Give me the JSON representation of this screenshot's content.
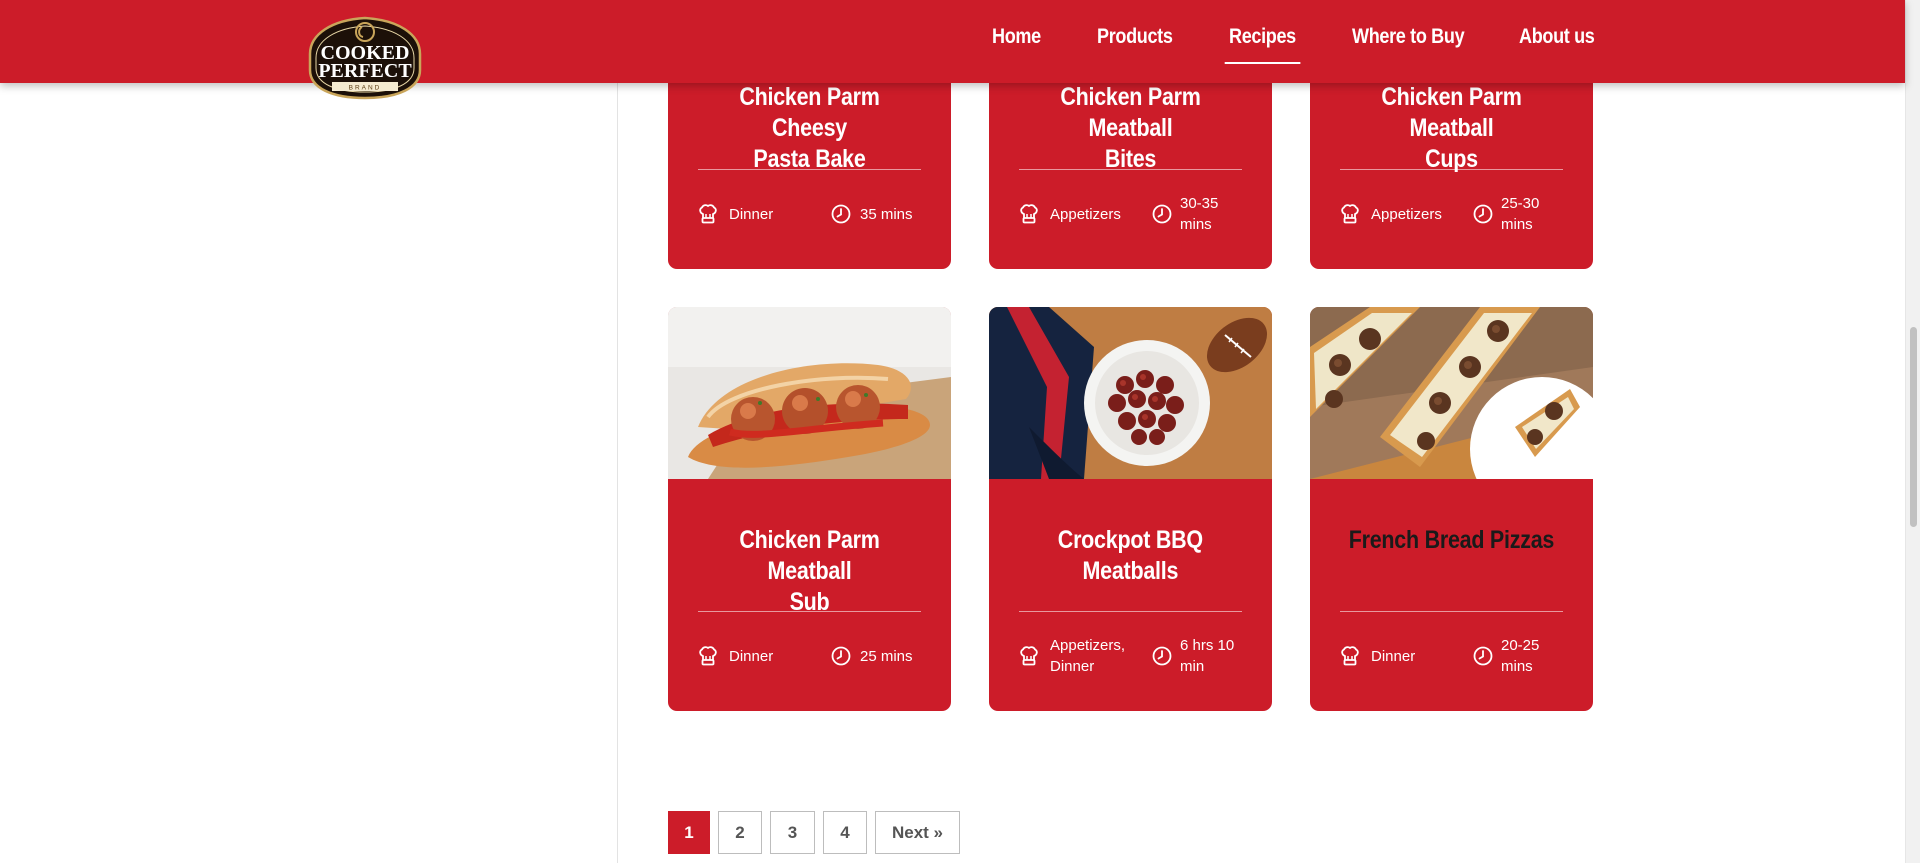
{
  "brand": {
    "logo_line1": "COOKED",
    "logo_line2": "PERFECT",
    "logo_line3": "BRAND",
    "accent": "#cc1c29"
  },
  "nav": {
    "items": [
      {
        "label": "Home"
      },
      {
        "label": "Products"
      },
      {
        "label": "Recipes",
        "active": true
      },
      {
        "label": "Where to Buy"
      },
      {
        "label": "About us"
      }
    ]
  },
  "recipes": [
    {
      "title_line1": "Chicken Parm Cheesy",
      "title_line2": "Pasta Bake",
      "category": "Dinner",
      "time": "35 mins",
      "category_icon": "chef-hat-icon",
      "time_icon": "clock-icon"
    },
    {
      "title_line1": "Chicken Parm Meatball",
      "title_line2": "Bites",
      "category": "Appetizers",
      "time_line1": "30-35",
      "time_line2": "mins",
      "category_icon": "chef-hat-icon",
      "time_icon": "clock-icon"
    },
    {
      "title_line1": "Chicken Parm Meatball",
      "title_line2": "Cups",
      "category": "Appetizers",
      "time_line1": "25-30",
      "time_line2": "mins",
      "category_icon": "chef-hat-icon",
      "time_icon": "clock-icon"
    },
    {
      "title_line1": "Chicken Parm Meatball",
      "title_line2": "Sub",
      "category": "Dinner",
      "time": "25 mins",
      "image": "meatball-sub-photo",
      "category_icon": "chef-hat-icon",
      "time_icon": "clock-icon"
    },
    {
      "title_line1": "Crockpot BBQ",
      "title_line2": "Meatballs",
      "category_line1": "Appetizers,",
      "category_line2": "Dinner",
      "time_line1": "6 hrs 10",
      "time_line2": "min",
      "image": "bbq-meatballs-photo",
      "category_icon": "chef-hat-icon",
      "time_icon": "clock-icon"
    },
    {
      "title_line1": "French Bread Pizzas",
      "category": "Dinner",
      "time_line1": "20-25",
      "time_line2": "mins",
      "image": "french-bread-pizza-photo",
      "category_icon": "chef-hat-icon",
      "time_icon": "clock-icon"
    }
  ],
  "pagination": {
    "pages": [
      "1",
      "2",
      "3",
      "4"
    ],
    "current": "1",
    "next_label": "Next »"
  }
}
